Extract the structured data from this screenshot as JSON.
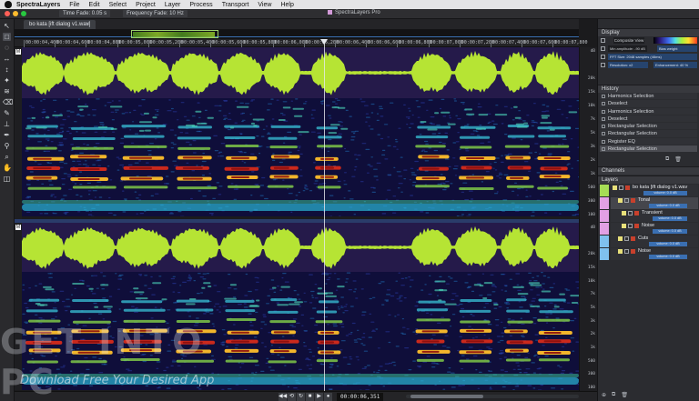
{
  "menubar": {
    "items": [
      "SpectraLayers",
      "File",
      "Edit",
      "Select",
      "Project",
      "Layer",
      "Process",
      "Transport",
      "View",
      "Help"
    ]
  },
  "titlebar": {
    "window_title": "SpectraLayers Pro",
    "time_fade": "Time Fade: 0.05 s",
    "frequency_fade": "Frequency Fade: 10 Hz"
  },
  "tab": {
    "label": "bo kata [ift dialog v1.wav]"
  },
  "ruler": {
    "ticks": [
      "00:00:04,400",
      "00:00:04,600",
      "00:00:04,800",
      "00:00:05,000",
      "00:00:05,200",
      "00:00:05,400",
      "00:00:05,600",
      "00:00:05,800",
      "00:00:06,000",
      "00:00:06,200",
      "00:00:06,400",
      "00:00:06,600",
      "00:00:06,800",
      "00:00:07,000",
      "00:00:07,200",
      "00:00:07,400",
      "00:00:07,600",
      "00:00:07,800"
    ]
  },
  "scale": {
    "track1": [
      "dB",
      "",
      "20k",
      "15k",
      "10k",
      "7k",
      "5k",
      "3k",
      "2k",
      "1k",
      "500",
      "300",
      "100"
    ],
    "track2": [
      "dB",
      "",
      "20k",
      "15k",
      "10k",
      "7k",
      "5k",
      "3k",
      "2k",
      "1k",
      "500",
      "300",
      "100"
    ]
  },
  "transport": {
    "buttons": [
      "◀◀",
      "⟲",
      "↻",
      "■",
      "▶",
      "●"
    ],
    "time": "00:00:06,351"
  },
  "watermark": {
    "title": "GET INTO PC",
    "subtitle": "Download Free Your Desired App"
  },
  "panels": {
    "display": {
      "title": "Display",
      "view_mode": "Composite View",
      "amplitude": "Min amplitude: -90 dB",
      "bias": "Bias weight",
      "fft": "FFT Size: 2048 samples (46ms)",
      "resolution": "Resolution: x2",
      "enhancement": "Enhancement: 40 %"
    },
    "history": {
      "title": "History",
      "items": [
        {
          "label": "Harmonics Selection",
          "selected": false
        },
        {
          "label": "Deselect",
          "selected": false
        },
        {
          "label": "Harmonics Selection",
          "selected": false
        },
        {
          "label": "Deselect",
          "selected": false
        },
        {
          "label": "Rectangular Selection",
          "selected": false
        },
        {
          "label": "Rectangular Selection",
          "selected": false
        },
        {
          "label": "Register EQ",
          "selected": false
        },
        {
          "label": "Rectangular Selection",
          "selected": true
        }
      ]
    },
    "channels": {
      "title": "Channels"
    },
    "layers": {
      "title": "Layers",
      "rows": [
        {
          "name": "bo kata [ift dialog v1.wav",
          "volume": "volume: 0.0 dB",
          "swatch": "#a6dd55"
        },
        {
          "name": "Tonal",
          "volume": "volume: 0.0 dB",
          "swatch": "#e2a0e4"
        },
        {
          "name": "Transient",
          "volume": "volume: 0.0 dB",
          "swatch": "#e2a0e4"
        },
        {
          "name": "Noise",
          "volume": "volume: 0.0 dB",
          "swatch": "#e2a0e4"
        },
        {
          "name": "Cuts",
          "volume": "volume: 0.0 dB",
          "swatch": "#7fc0ee"
        },
        {
          "name": "Noise",
          "volume": "volume: 0.0 dB",
          "swatch": "#7fc0ee"
        }
      ]
    }
  },
  "colors": {
    "waveform": "#b6e434",
    "spectrogram_bg": "#0f0e3a",
    "accent_blue": "#3a6fb2"
  }
}
